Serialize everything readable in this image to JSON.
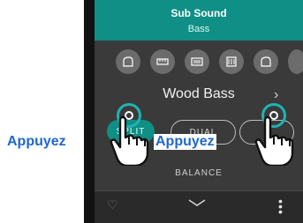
{
  "header": {
    "title": "Sub Sound",
    "subtitle": "Bass"
  },
  "instrument": {
    "name": "Wood Bass",
    "chevron": "›"
  },
  "modes": [
    {
      "label": "SPLIT"
    },
    {
      "label": "DUAL"
    },
    {
      "label": ""
    }
  ],
  "balance": {
    "label": "BALANCE"
  },
  "bottom": {
    "favorite_icon": "heart-outline-icon",
    "collapse_icon": "chevron-down-icon",
    "menu_icon": "kebab-menu-icon"
  },
  "callouts": {
    "left": "Appuyez",
    "right": "Appuyez"
  },
  "colors": {
    "accent": "#0f8f86",
    "callout": "#1f66d1",
    "tapRing": "#1fb3b3"
  }
}
